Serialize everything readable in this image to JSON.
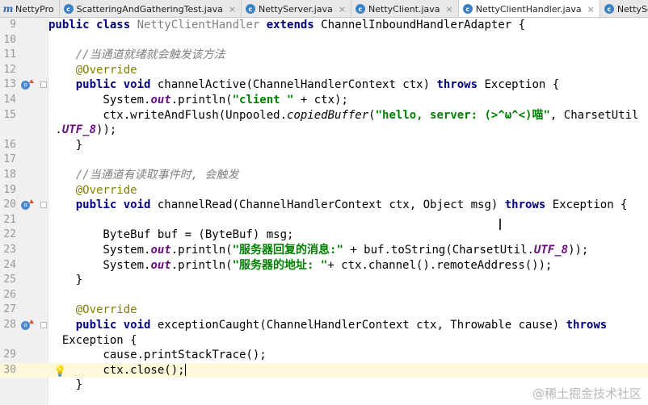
{
  "tabs": [
    {
      "label": "NettyPro",
      "icon": "module-icon",
      "active": false,
      "closable": false
    },
    {
      "label": "ScatteringAndGatheringTest.java",
      "icon": "java-class-icon",
      "active": false,
      "closable": true
    },
    {
      "label": "NettyServer.java",
      "icon": "java-class-icon",
      "active": false,
      "closable": true
    },
    {
      "label": "NettyClient.java",
      "icon": "java-class-icon",
      "active": false,
      "closable": true
    },
    {
      "label": "NettyClientHandler.java",
      "icon": "java-class-icon",
      "active": true,
      "closable": true
    },
    {
      "label": "NettyServerHandler.java",
      "icon": "java-class-icon",
      "active": false,
      "closable": true
    }
  ],
  "close_glyph": "×",
  "class_icon_letter": "c",
  "module_icon_letter": "m",
  "override_marker_letter": "o",
  "lightbulb_glyph": "💡",
  "current_line": 30,
  "lines": [
    {
      "n": "9",
      "segs": [
        [
          "kw",
          "public class "
        ],
        [
          "gry",
          "NettyClientHandler "
        ],
        [
          "kw",
          "extends "
        ],
        [
          "",
          "ChannelInboundHandlerAdapter {"
        ]
      ]
    },
    {
      "n": "10",
      "segs": []
    },
    {
      "n": "11",
      "segs": [
        [
          "",
          "    "
        ],
        [
          "cmt",
          "//当通道就绪就会触发该方法"
        ]
      ]
    },
    {
      "n": "12",
      "segs": [
        [
          "",
          "    "
        ],
        [
          "ann",
          "@Override"
        ]
      ]
    },
    {
      "n": "13",
      "marker": true,
      "fold": true,
      "segs": [
        [
          "",
          "    "
        ],
        [
          "kw",
          "public void "
        ],
        [
          "",
          "channelActive(ChannelHandlerContext ctx) "
        ],
        [
          "kw",
          "throws "
        ],
        [
          "",
          "Exception {"
        ]
      ]
    },
    {
      "n": "14",
      "segs": [
        [
          "",
          "        System."
        ],
        [
          "fld",
          "out"
        ],
        [
          "",
          ".println("
        ],
        [
          "str",
          "\"client \""
        ],
        [
          "",
          " + ctx);"
        ]
      ]
    },
    {
      "n": "15",
      "segs": [
        [
          "",
          "        ctx.writeAndFlush(Unpooled."
        ],
        [
          "itl",
          "copiedBuffer"
        ],
        [
          "",
          "("
        ],
        [
          "str",
          "\"hello, server: (>^ω^<)喵\""
        ],
        [
          "",
          ", CharsetUtil"
        ]
      ]
    },
    {
      "n": "",
      "segs": [
        [
          "",
          " ."
        ],
        [
          "fld",
          "UTF_8"
        ],
        [
          "",
          "));"
        ]
      ]
    },
    {
      "n": "16",
      "segs": [
        [
          "",
          "    }"
        ]
      ]
    },
    {
      "n": "17",
      "segs": []
    },
    {
      "n": "18",
      "segs": [
        [
          "",
          "    "
        ],
        [
          "cmt",
          "//当通道有读取事件时, 会触发"
        ]
      ]
    },
    {
      "n": "19",
      "segs": [
        [
          "",
          "    "
        ],
        [
          "ann",
          "@Override"
        ]
      ]
    },
    {
      "n": "20",
      "marker": true,
      "fold": true,
      "segs": [
        [
          "",
          "    "
        ],
        [
          "kw",
          "public void "
        ],
        [
          "",
          "channelRead(ChannelHandlerContext ctx, Object msg) "
        ],
        [
          "kw",
          "throws "
        ],
        [
          "",
          "Exception {"
        ]
      ]
    },
    {
      "n": "21",
      "segs": []
    },
    {
      "n": "22",
      "segs": [
        [
          "",
          "        ByteBuf buf = (ByteBuf) msg;"
        ]
      ]
    },
    {
      "n": "23",
      "segs": [
        [
          "",
          "        System."
        ],
        [
          "fld",
          "out"
        ],
        [
          "",
          ".println("
        ],
        [
          "str",
          "\"服务器回复的消息:\""
        ],
        [
          "",
          " + buf.toString(CharsetUtil."
        ],
        [
          "fld",
          "UTF_8"
        ],
        [
          "",
          "));"
        ]
      ]
    },
    {
      "n": "24",
      "segs": [
        [
          "",
          "        System."
        ],
        [
          "fld",
          "out"
        ],
        [
          "",
          ".println("
        ],
        [
          "str",
          "\"服务器的地址: \""
        ],
        [
          "",
          "+ ctx.channel().remoteAddress());"
        ]
      ]
    },
    {
      "n": "25",
      "segs": [
        [
          "",
          "    }"
        ]
      ]
    },
    {
      "n": "26",
      "segs": []
    },
    {
      "n": "27",
      "segs": [
        [
          "",
          "    "
        ],
        [
          "ann",
          "@Override"
        ]
      ]
    },
    {
      "n": "28",
      "marker": true,
      "fold": true,
      "segs": [
        [
          "",
          "    "
        ],
        [
          "kw",
          "public void "
        ],
        [
          "",
          "exceptionCaught(ChannelHandlerContext ctx, Throwable cause) "
        ],
        [
          "kw",
          "throws"
        ]
      ]
    },
    {
      "n": "",
      "segs": [
        [
          "",
          "  Exception {"
        ]
      ]
    },
    {
      "n": "29",
      "segs": [
        [
          "",
          "        cause.printStackTrace();"
        ]
      ]
    },
    {
      "n": "30",
      "bulb": true,
      "caret": true,
      "segs": [
        [
          "",
          "        ctx.close();"
        ]
      ]
    },
    {
      "n": "",
      "segs": [
        [
          "",
          "    }"
        ]
      ]
    }
  ],
  "watermark": "@稀土掘金技术社区"
}
